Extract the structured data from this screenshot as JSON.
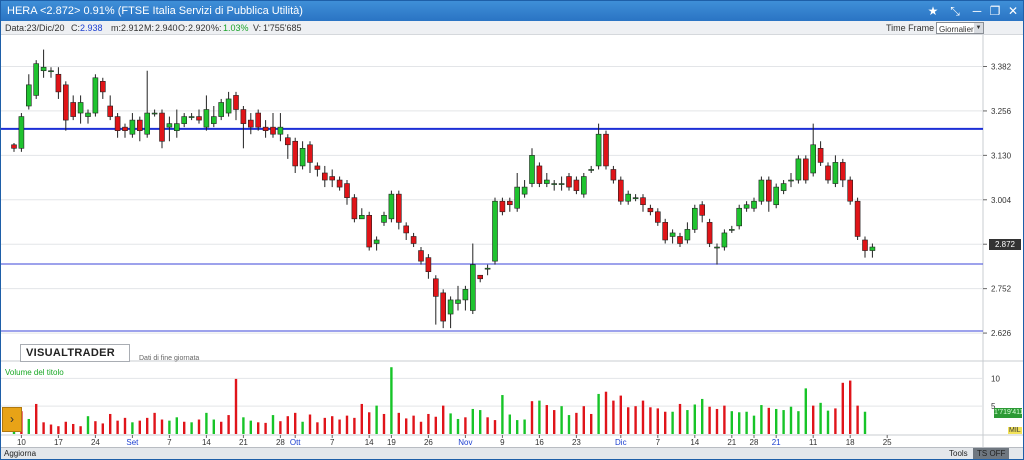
{
  "window": {
    "title": "HERA <2.872>  0.91%  (FTSE Italia Servizi di Pubblica Utilità)",
    "controls": [
      "★",
      "⤡",
      "─",
      "❐",
      "✕"
    ]
  },
  "info": {
    "date": "Data:23/Dic/20",
    "close_label": "C:",
    "close": "2.938",
    "min_label": "m:",
    "min": "2.912",
    "max_label": "M:",
    "max": "2.940",
    "open_label": "O:",
    "open": "2.920",
    "pct_label": "%:",
    "pct": "1.03%",
    "vol_label": "V:",
    "vol": "1'755'685",
    "timeframe_label": "Time Frame",
    "timeframe_value": "Giornaliero"
  },
  "logo_text": "VISUALTRADER",
  "eod_text": "Dati di fine giornata",
  "volume_title": "Volume del titolo",
  "price_flag": "2.872",
  "volume_flag": "1'719'411",
  "mil_tag": "MIL",
  "bottom": {
    "aggiorna": "Aggiorna",
    "tools": "Tools",
    "tsoff": "TS OFF"
  },
  "chart_data": [
    {
      "type": "candlestick",
      "y_axis": {
        "ticks": [
          "3.382",
          "3.256",
          "3.130",
          "3.004",
          "2.878",
          "2.752",
          "2.626"
        ],
        "range": [
          2.595,
          3.46
        ],
        "position": "right"
      },
      "x_axis": {
        "ticks": [
          {
            "label": "10",
            "i": 1
          },
          {
            "label": "17",
            "i": 6
          },
          {
            "label": "24",
            "i": 11
          },
          {
            "label": "Set",
            "i": 16,
            "month": true
          },
          {
            "label": "7",
            "i": 21
          },
          {
            "label": "14",
            "i": 26
          },
          {
            "label": "21",
            "i": 31
          },
          {
            "label": "28",
            "i": 36
          },
          {
            "label": "Ott",
            "i": 38,
            "month": true
          },
          {
            "label": "7",
            "i": 43
          },
          {
            "label": "14",
            "i": 48
          },
          {
            "label": "19",
            "i": 51
          },
          {
            "label": "26",
            "i": 56
          },
          {
            "label": "Nov",
            "i": 61,
            "month": true
          },
          {
            "label": "9",
            "i": 66
          },
          {
            "label": "16",
            "i": 71
          },
          {
            "label": "23",
            "i": 76
          },
          {
            "label": "Dic",
            "i": 82,
            "month": true
          },
          {
            "label": "7",
            "i": 87
          },
          {
            "label": "14",
            "i": 92
          },
          {
            "label": "21",
            "i": 97
          },
          {
            "label": "28",
            "i": 100
          },
          {
            "label": "21",
            "i": 103,
            "month": true
          },
          {
            "label": "11",
            "i": 108
          },
          {
            "label": "18",
            "i": 113
          },
          {
            "label": "25",
            "i": 118
          }
        ]
      },
      "horizontal_lines": [
        {
          "value": 3.205,
          "color": "#1c2fd6",
          "width": 2
        },
        {
          "value": 2.822,
          "color": "#3b46d8",
          "width": 1
        },
        {
          "value": 2.632,
          "color": "#3b46d8",
          "width": 1
        }
      ],
      "candles": [
        [
          3.16,
          3.15,
          3.165,
          3.14
        ],
        [
          3.15,
          3.24,
          3.25,
          3.14
        ],
        [
          3.27,
          3.33,
          3.36,
          3.26
        ],
        [
          3.3,
          3.39,
          3.4,
          3.29
        ],
        [
          3.37,
          3.38,
          3.43,
          3.35
        ],
        [
          3.37,
          3.37,
          3.38,
          3.35
        ],
        [
          3.36,
          3.31,
          3.38,
          3.29
        ],
        [
          3.33,
          3.23,
          3.34,
          3.2
        ],
        [
          3.28,
          3.24,
          3.3,
          3.23
        ],
        [
          3.25,
          3.28,
          3.3,
          3.22
        ],
        [
          3.24,
          3.25,
          3.26,
          3.22
        ],
        [
          3.25,
          3.35,
          3.36,
          3.24
        ],
        [
          3.34,
          3.31,
          3.35,
          3.29
        ],
        [
          3.27,
          3.24,
          3.3,
          3.23
        ],
        [
          3.24,
          3.2,
          3.25,
          3.18
        ],
        [
          3.21,
          3.2,
          3.22,
          3.18
        ],
        [
          3.19,
          3.23,
          3.25,
          3.18
        ],
        [
          3.23,
          3.2,
          3.24,
          3.17
        ],
        [
          3.19,
          3.25,
          3.37,
          3.18
        ],
        [
          3.25,
          3.25,
          3.26,
          3.24
        ],
        [
          3.25,
          3.17,
          3.26,
          3.15
        ],
        [
          3.21,
          3.22,
          3.24,
          3.17
        ],
        [
          3.2,
          3.22,
          3.26,
          3.18
        ],
        [
          3.22,
          3.24,
          3.25,
          3.21
        ],
        [
          3.24,
          3.24,
          3.25,
          3.23
        ],
        [
          3.24,
          3.23,
          3.26,
          3.22
        ],
        [
          3.21,
          3.26,
          3.3,
          3.2
        ],
        [
          3.22,
          3.24,
          3.27,
          3.21
        ],
        [
          3.24,
          3.28,
          3.29,
          3.23
        ],
        [
          3.25,
          3.29,
          3.31,
          3.24
        ],
        [
          3.3,
          3.26,
          3.31,
          3.23
        ],
        [
          3.26,
          3.22,
          3.27,
          3.15
        ],
        [
          3.23,
          3.21,
          3.25,
          3.19
        ],
        [
          3.25,
          3.21,
          3.26,
          3.2
        ],
        [
          3.21,
          3.2,
          3.23,
          3.18
        ],
        [
          3.21,
          3.19,
          3.25,
          3.18
        ],
        [
          3.19,
          3.21,
          3.25,
          3.17
        ],
        [
          3.18,
          3.16,
          3.19,
          3.12
        ],
        [
          3.17,
          3.1,
          3.18,
          3.08
        ],
        [
          3.1,
          3.15,
          3.17,
          3.09
        ],
        [
          3.16,
          3.11,
          3.17,
          3.08
        ],
        [
          3.1,
          3.09,
          3.11,
          3.07
        ],
        [
          3.08,
          3.06,
          3.1,
          3.04
        ],
        [
          3.07,
          3.06,
          3.09,
          3.04
        ],
        [
          3.06,
          3.04,
          3.07,
          3.03
        ],
        [
          3.05,
          3.01,
          3.06,
          2.99
        ],
        [
          3.01,
          2.95,
          3.02,
          2.94
        ],
        [
          2.95,
          2.96,
          2.98,
          2.95
        ],
        [
          2.96,
          2.87,
          2.97,
          2.86
        ],
        [
          2.88,
          2.89,
          2.9,
          2.86
        ],
        [
          2.94,
          2.96,
          2.97,
          2.93
        ],
        [
          2.95,
          3.02,
          3.03,
          2.94
        ],
        [
          3.02,
          2.94,
          3.03,
          2.92
        ],
        [
          2.93,
          2.91,
          2.94,
          2.89
        ],
        [
          2.9,
          2.88,
          2.91,
          2.87
        ],
        [
          2.86,
          2.83,
          2.87,
          2.82
        ],
        [
          2.84,
          2.8,
          2.85,
          2.78
        ],
        [
          2.78,
          2.73,
          2.79,
          2.65
        ],
        [
          2.74,
          2.66,
          2.75,
          2.64
        ],
        [
          2.68,
          2.72,
          2.73,
          2.64
        ],
        [
          2.71,
          2.72,
          2.76,
          2.69
        ],
        [
          2.72,
          2.75,
          2.76,
          2.69
        ],
        [
          2.69,
          2.82,
          2.88,
          2.68
        ],
        [
          2.79,
          2.78,
          2.79,
          2.77
        ],
        [
          2.81,
          2.81,
          2.82,
          2.79
        ],
        [
          2.83,
          3.0,
          3.01,
          2.82
        ],
        [
          3.0,
          2.97,
          3.01,
          2.96
        ],
        [
          3.0,
          2.99,
          3.01,
          2.97
        ],
        [
          2.98,
          3.04,
          3.08,
          2.97
        ],
        [
          3.02,
          3.04,
          3.06,
          3.01
        ],
        [
          3.05,
          3.13,
          3.15,
          3.04
        ],
        [
          3.1,
          3.05,
          3.11,
          3.04
        ],
        [
          3.05,
          3.06,
          3.08,
          3.04
        ],
        [
          3.05,
          3.05,
          3.06,
          3.03
        ],
        [
          3.05,
          3.05,
          3.07,
          3.03
        ],
        [
          3.07,
          3.04,
          3.08,
          3.03
        ],
        [
          3.06,
          3.03,
          3.07,
          3.02
        ],
        [
          3.02,
          3.07,
          3.08,
          3.01
        ],
        [
          3.09,
          3.09,
          3.1,
          3.08
        ],
        [
          3.1,
          3.19,
          3.22,
          3.09
        ],
        [
          3.19,
          3.1,
          3.2,
          3.09
        ],
        [
          3.09,
          3.06,
          3.1,
          3.05
        ],
        [
          3.06,
          3.0,
          3.07,
          2.99
        ],
        [
          3.0,
          3.02,
          3.03,
          2.99
        ],
        [
          3.01,
          3.01,
          3.02,
          3.0
        ],
        [
          3.01,
          2.99,
          3.02,
          2.97
        ],
        [
          2.98,
          2.97,
          2.99,
          2.96
        ],
        [
          2.97,
          2.94,
          2.98,
          2.93
        ],
        [
          2.94,
          2.89,
          2.95,
          2.88
        ],
        [
          2.9,
          2.91,
          2.92,
          2.88
        ],
        [
          2.9,
          2.88,
          2.91,
          2.87
        ],
        [
          2.89,
          2.92,
          2.94,
          2.88
        ],
        [
          2.92,
          2.98,
          2.99,
          2.91
        ],
        [
          2.99,
          2.96,
          3.0,
          2.94
        ],
        [
          2.94,
          2.88,
          2.95,
          2.87
        ],
        [
          2.87,
          2.87,
          2.88,
          2.82
        ],
        [
          2.87,
          2.91,
          2.92,
          2.86
        ],
        [
          2.92,
          2.92,
          2.93,
          2.91
        ],
        [
          2.93,
          2.98,
          2.99,
          2.92
        ],
        [
          2.98,
          2.99,
          3.0,
          2.97
        ],
        [
          2.98,
          3.0,
          3.01,
          2.97
        ],
        [
          3.0,
          3.06,
          3.07,
          2.99
        ],
        [
          3.06,
          3.0,
          3.07,
          2.97
        ],
        [
          2.99,
          3.04,
          3.05,
          2.98
        ],
        [
          3.03,
          3.05,
          3.06,
          3.02
        ],
        [
          3.06,
          3.06,
          3.08,
          3.04
        ],
        [
          3.06,
          3.12,
          3.13,
          3.05
        ],
        [
          3.12,
          3.06,
          3.13,
          3.05
        ],
        [
          3.08,
          3.16,
          3.22,
          3.07
        ],
        [
          3.15,
          3.11,
          3.17,
          3.1
        ],
        [
          3.1,
          3.06,
          3.11,
          3.05
        ],
        [
          3.05,
          3.11,
          3.13,
          3.04
        ],
        [
          3.11,
          3.06,
          3.12,
          3.04
        ],
        [
          3.06,
          3.0,
          3.07,
          2.99
        ],
        [
          3.0,
          2.9,
          3.01,
          2.89
        ],
        [
          2.89,
          2.86,
          2.9,
          2.84
        ],
        [
          2.86,
          2.87,
          2.88,
          2.84
        ]
      ]
    },
    {
      "type": "bar",
      "series": [
        {
          "name": "Volume del titolo"
        }
      ],
      "y_axis": {
        "ticks": [
          "10",
          "5"
        ],
        "range": [
          0,
          11.5
        ],
        "position": "right"
      },
      "values": [
        [
          2.5,
          "g"
        ],
        [
          4.1,
          "r"
        ],
        [
          2.7,
          "g"
        ],
        [
          5.4,
          "r"
        ],
        [
          2.1,
          "r"
        ],
        [
          1.7,
          "r"
        ],
        [
          1.4,
          "r"
        ],
        [
          2.2,
          "r"
        ],
        [
          1.8,
          "r"
        ],
        [
          1.4,
          "r"
        ],
        [
          3.2,
          "g"
        ],
        [
          2.3,
          "r"
        ],
        [
          1.9,
          "r"
        ],
        [
          3.6,
          "r"
        ],
        [
          2.4,
          "r"
        ],
        [
          2.9,
          "r"
        ],
        [
          2.1,
          "g"
        ],
        [
          2.4,
          "r"
        ],
        [
          2.9,
          "r"
        ],
        [
          3.8,
          "r"
        ],
        [
          2.6,
          "r"
        ],
        [
          2.4,
          "g"
        ],
        [
          3.0,
          "g"
        ],
        [
          2.2,
          "r"
        ],
        [
          2.1,
          "g"
        ],
        [
          2.6,
          "r"
        ],
        [
          3.8,
          "g"
        ],
        [
          2.6,
          "g"
        ],
        [
          2.2,
          "r"
        ],
        [
          3.4,
          "r"
        ],
        [
          9.9,
          "r"
        ],
        [
          3.0,
          "g"
        ],
        [
          2.4,
          "g"
        ],
        [
          2.1,
          "r"
        ],
        [
          2.0,
          "r"
        ],
        [
          3.4,
          "g"
        ],
        [
          2.3,
          "r"
        ],
        [
          3.2,
          "r"
        ],
        [
          3.8,
          "r"
        ],
        [
          2.2,
          "g"
        ],
        [
          3.5,
          "r"
        ],
        [
          2.1,
          "r"
        ],
        [
          2.9,
          "r"
        ],
        [
          3.2,
          "r"
        ],
        [
          2.6,
          "r"
        ],
        [
          3.3,
          "r"
        ],
        [
          2.9,
          "r"
        ],
        [
          5.4,
          "r"
        ],
        [
          3.9,
          "r"
        ],
        [
          5.1,
          "g"
        ],
        [
          3.6,
          "r"
        ],
        [
          12.0,
          "g"
        ],
        [
          3.8,
          "r"
        ],
        [
          2.8,
          "r"
        ],
        [
          3.3,
          "r"
        ],
        [
          2.2,
          "r"
        ],
        [
          3.6,
          "r"
        ],
        [
          3.1,
          "r"
        ],
        [
          5.1,
          "r"
        ],
        [
          3.7,
          "g"
        ],
        [
          2.7,
          "g"
        ],
        [
          3.0,
          "r"
        ],
        [
          4.5,
          "g"
        ],
        [
          4.3,
          "g"
        ],
        [
          3.0,
          "r"
        ],
        [
          2.5,
          "r"
        ],
        [
          7.0,
          "g"
        ],
        [
          3.5,
          "g"
        ],
        [
          2.5,
          "g"
        ],
        [
          2.6,
          "g"
        ],
        [
          5.9,
          "r"
        ],
        [
          6.0,
          "g"
        ],
        [
          5.2,
          "r"
        ],
        [
          4.3,
          "r"
        ],
        [
          5.0,
          "g"
        ],
        [
          3.4,
          "g"
        ],
        [
          3.8,
          "r"
        ],
        [
          5.0,
          "r"
        ],
        [
          3.6,
          "r"
        ],
        [
          7.2,
          "g"
        ],
        [
          7.6,
          "r"
        ],
        [
          6.0,
          "r"
        ],
        [
          6.9,
          "r"
        ],
        [
          4.8,
          "r"
        ],
        [
          5.0,
          "r"
        ],
        [
          6.0,
          "r"
        ],
        [
          4.8,
          "r"
        ],
        [
          4.6,
          "r"
        ],
        [
          4.0,
          "r"
        ],
        [
          4.0,
          "g"
        ],
        [
          5.4,
          "r"
        ],
        [
          4.3,
          "g"
        ],
        [
          5.3,
          "g"
        ],
        [
          6.3,
          "g"
        ],
        [
          4.9,
          "r"
        ],
        [
          4.5,
          "r"
        ],
        [
          5.1,
          "r"
        ],
        [
          4.1,
          "g"
        ],
        [
          3.9,
          "g"
        ],
        [
          4.0,
          "g"
        ],
        [
          3.3,
          "g"
        ],
        [
          5.2,
          "g"
        ],
        [
          4.7,
          "r"
        ],
        [
          4.5,
          "g"
        ],
        [
          4.3,
          "g"
        ],
        [
          4.9,
          "g"
        ],
        [
          4.1,
          "g"
        ],
        [
          8.2,
          "g"
        ],
        [
          5.1,
          "r"
        ],
        [
          5.6,
          "g"
        ],
        [
          4.2,
          "g"
        ],
        [
          4.6,
          "r"
        ],
        [
          9.2,
          "r"
        ],
        [
          9.6,
          "r"
        ],
        [
          5.1,
          "r"
        ],
        [
          4.0,
          "g"
        ]
      ]
    }
  ]
}
